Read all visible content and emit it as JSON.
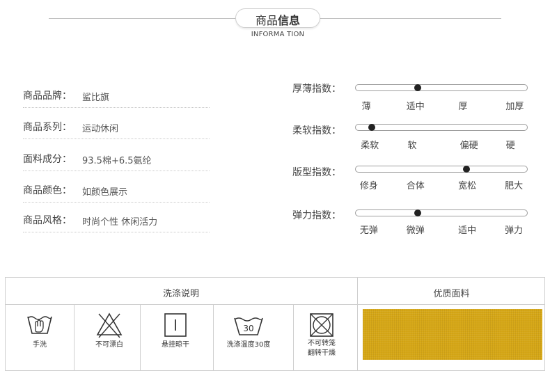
{
  "header": {
    "title_normal": "商品",
    "title_bold": "信息",
    "subtitle": "INFORMA TION"
  },
  "info": [
    {
      "key": "商品品牌：",
      "value": "鲨比旗"
    },
    {
      "key": "商品系列：",
      "value": "运动休闲"
    },
    {
      "key": "面料成分：",
      "value": "93.5棉+6.5氨纶"
    },
    {
      "key": "商品颜色：",
      "value": "如颜色展示"
    },
    {
      "key": "商品风格：",
      "value": "时尚个性  休闲活力"
    }
  ],
  "indices": [
    {
      "label": "厚薄指数：",
      "options": [
        "薄",
        "适中",
        "厚",
        "加厚"
      ],
      "level": 0.36
    },
    {
      "label": "柔软指数：",
      "options": [
        "柔软",
        "软",
        "偏硬",
        "硬"
      ],
      "level": 0.095
    },
    {
      "label": "版型指数：",
      "options": [
        "修身",
        "合体",
        "宽松",
        "肥大"
      ],
      "level": 0.645
    },
    {
      "label": "弹力指数：",
      "options": [
        "无弹",
        "微弹",
        "适中",
        "弹力"
      ],
      "level": 0.36
    }
  ],
  "care": {
    "heading": "洗涤说明",
    "items": [
      {
        "icon": "hand-wash-icon",
        "caption": "手洗"
      },
      {
        "icon": "no-bleach-icon",
        "caption": "不可漂白"
      },
      {
        "icon": "line-dry-icon",
        "caption": "悬挂晾干"
      },
      {
        "icon": "wash-30-icon",
        "caption": "洗涤温度30度",
        "temp": "30"
      },
      {
        "icon": "no-tumble-dry-icon",
        "caption": "不可转笼\n翻转干燥"
      }
    ]
  },
  "fabric": {
    "heading": "优质面料",
    "color": "#d6a716"
  }
}
